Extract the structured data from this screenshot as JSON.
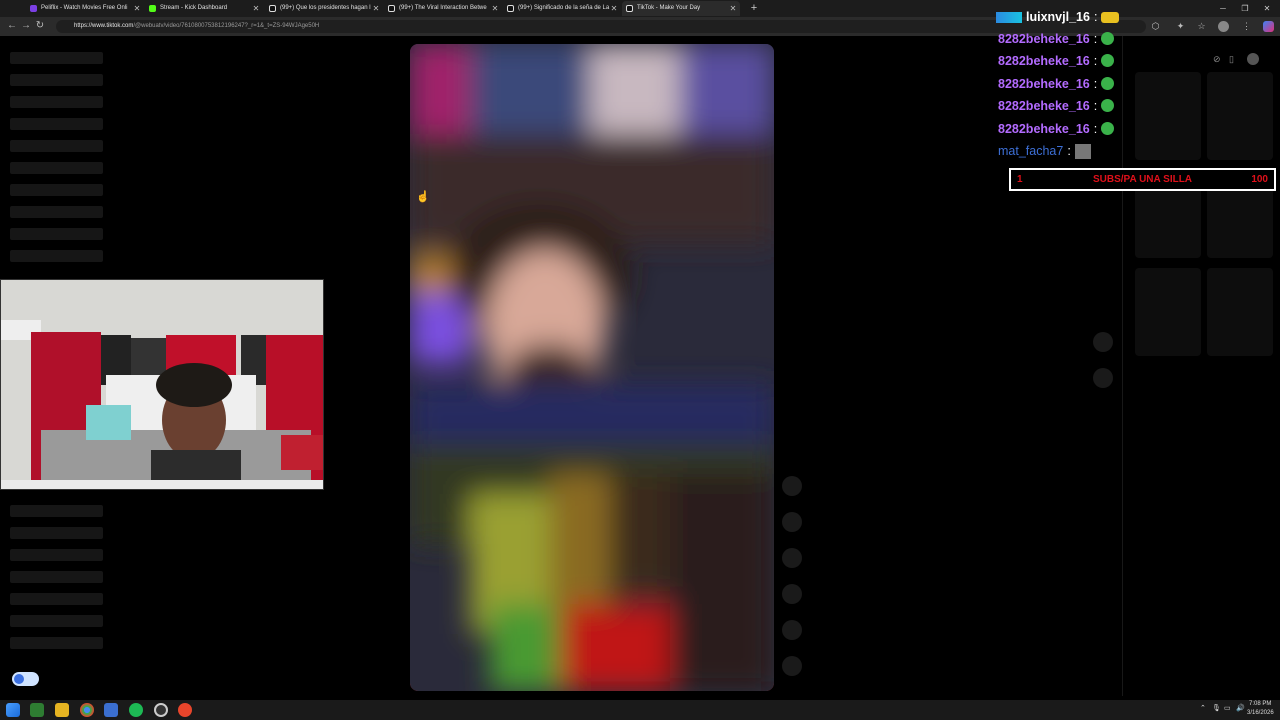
{
  "browser": {
    "tabs": [
      {
        "title": "Peliflix - Watch Movies Free Onli",
        "icon": "peliflix-icon",
        "color": "#7b3fe4"
      },
      {
        "title": "Stream - Kick Dashboard",
        "icon": "kick-icon",
        "color": "#53fc18"
      },
      {
        "title": "(99+) Que los presidentes hagan l",
        "icon": "tiktok-icon",
        "color": "#ffffff"
      },
      {
        "title": "(99+) The Viral Interaction Betwe",
        "icon": "tiktok-icon",
        "color": "#ffffff"
      },
      {
        "title": "(99+) Significado de la seña de La",
        "icon": "tiktok-icon",
        "color": "#ffffff"
      },
      {
        "title": "TikTok - Make Your Day",
        "icon": "tiktok-icon",
        "color": "#ffffff",
        "active": true
      }
    ],
    "new_tab_label": "+",
    "url_domain": "https://www.tiktok.com",
    "url_path": "/@webuatv/video/7610800753812196247?_r=1&_t=ZS-94WJAge50H"
  },
  "chat": {
    "lines": [
      {
        "user": "luixnvjl_16",
        "color": "#ffffff"
      },
      {
        "user": "8282beheke_16",
        "color": "#b36bff"
      },
      {
        "user": "8282beheke_16",
        "color": "#b36bff"
      },
      {
        "user": "8282beheke_16",
        "color": "#b36bff"
      },
      {
        "user": "8282beheke_16",
        "color": "#b36bff"
      },
      {
        "user": "8282beheke_16",
        "color": "#b36bff"
      },
      {
        "user": "mat_facha7",
        "color": "#3d6fd6"
      }
    ],
    "colon": ":"
  },
  "subs_goal": {
    "current": "1",
    "label": "SUBS/PA UNA SILLA",
    "target": "100"
  },
  "taskbar": {
    "time": "7:08 PM",
    "date": "3/16/2026"
  },
  "colors": {
    "accent_red": "#e0101a",
    "chat_purple": "#b36bff"
  }
}
